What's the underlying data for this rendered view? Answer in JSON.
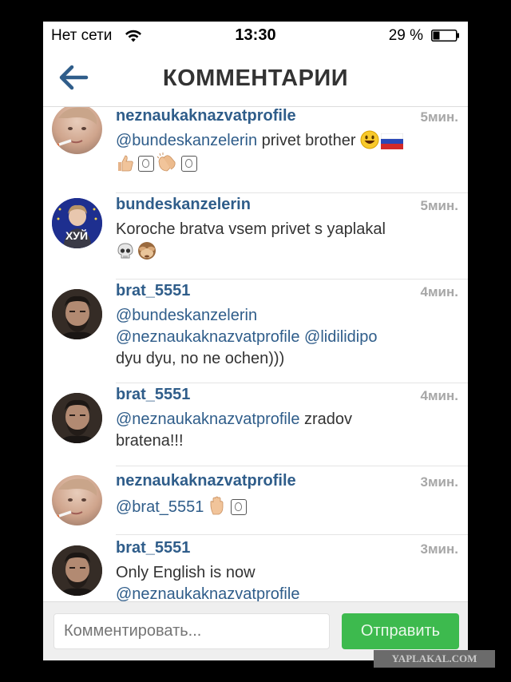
{
  "status_bar": {
    "carrier": "Нет сети",
    "time": "13:30",
    "battery_percent": "29 %",
    "wifi_icon": "wifi-icon",
    "battery_icon": "battery-icon",
    "battery_level": 0.29
  },
  "navbar": {
    "title": "КОММЕНТАРИИ",
    "back_icon": "arrow-left-icon"
  },
  "comments": [
    {
      "username": "neznaukaknazvatprofile",
      "time": "5мин.",
      "text_parts": [
        {
          "type": "mention",
          "text": "@bundeskanzelerin"
        },
        {
          "type": "text",
          "text": " privet brother"
        }
      ],
      "emojis": [
        "smiley-icon",
        "russia-flag-icon",
        "thumbs-up-icon",
        "alien-box-icon",
        "clapping-hands-icon",
        "alien-box-icon"
      ]
    },
    {
      "username": "bundeskanzelerin",
      "time": "5мин.",
      "text_parts": [
        {
          "type": "text",
          "text": "Koroche bratva vsem privet s yaplakal"
        }
      ],
      "emojis": [
        "skull-icon",
        "see-no-evil-monkey-icon"
      ],
      "avatar_caption": "ХУЙ"
    },
    {
      "username": "brat_5551",
      "time": "4мин.",
      "text_parts": [
        {
          "type": "mention",
          "text": "@bundeskanzelerin"
        },
        {
          "type": "mention",
          "text": "@neznaukaknazvatprofile"
        },
        {
          "type": "mention",
          "text": "@lidilidipo"
        },
        {
          "type": "text",
          "text": "dyu dyu, no ne ochen)))"
        }
      ]
    },
    {
      "username": "brat_5551",
      "time": "4мин.",
      "text_parts": [
        {
          "type": "mention",
          "text": "@neznaukaknazvatprofile"
        },
        {
          "type": "text",
          "text": " zradov"
        },
        {
          "type": "text",
          "text": "bratena!!!"
        }
      ]
    },
    {
      "username": "neznaukaknazvatprofile",
      "time": "3мин.",
      "text_parts": [
        {
          "type": "mention",
          "text": "@brat_5551"
        }
      ],
      "emojis": [
        "raised-hand-icon",
        "alien-box-icon"
      ]
    },
    {
      "username": "brat_5551",
      "time": "3мин.",
      "text_parts": [
        {
          "type": "text",
          "text": "Only English is now"
        },
        {
          "type": "mention",
          "text": "@neznaukaknazvatprofile"
        }
      ]
    }
  ],
  "footer": {
    "input_placeholder": "Комментировать...",
    "send_label": "Отправить"
  },
  "watermark": "YAPLAKAL.COM",
  "colors": {
    "mention": "#2f5d8a",
    "send_button": "#3dba4e",
    "time": "#a7a7a7",
    "text": "#333333"
  }
}
